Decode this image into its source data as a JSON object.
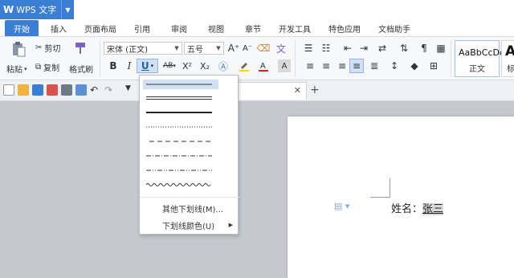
{
  "app": {
    "logo": "W",
    "name": "WPS 文字"
  },
  "tabs": [
    "开始",
    "插入",
    "页面布局",
    "引用",
    "审阅",
    "视图",
    "章节",
    "开发工具",
    "特色应用",
    "文档助手"
  ],
  "ribbon": {
    "paste": "粘贴",
    "cut": "剪切",
    "copy": "复制",
    "format_painter": "格式刷",
    "font_name": "宋体 (正文)",
    "font_size": "五号",
    "bold": "B",
    "italic": "I",
    "underline": "U",
    "strikethrough": "AB",
    "superscript": "X²",
    "subscript": "X₂",
    "styles": [
      {
        "sample": "AaBbCcDd",
        "name": "正文"
      },
      {
        "sample": "Aa",
        "name": "标"
      }
    ]
  },
  "colors": {
    "accent": "#3b7ed6",
    "selection": "#cfe0f7",
    "font_color_bar": "#e02020",
    "highlight_bar": "#ffd400"
  },
  "underline_menu": {
    "line_styles": [
      "single",
      "double",
      "thick",
      "dotted",
      "dashed",
      "dash-dot",
      "dash-dot-dot",
      "wavy"
    ],
    "selected_index": 0,
    "more_underlines": "其他下划线(M)...",
    "underline_color": "下划线颜色(U)"
  },
  "document": {
    "label": "姓名：",
    "value": "张三"
  }
}
